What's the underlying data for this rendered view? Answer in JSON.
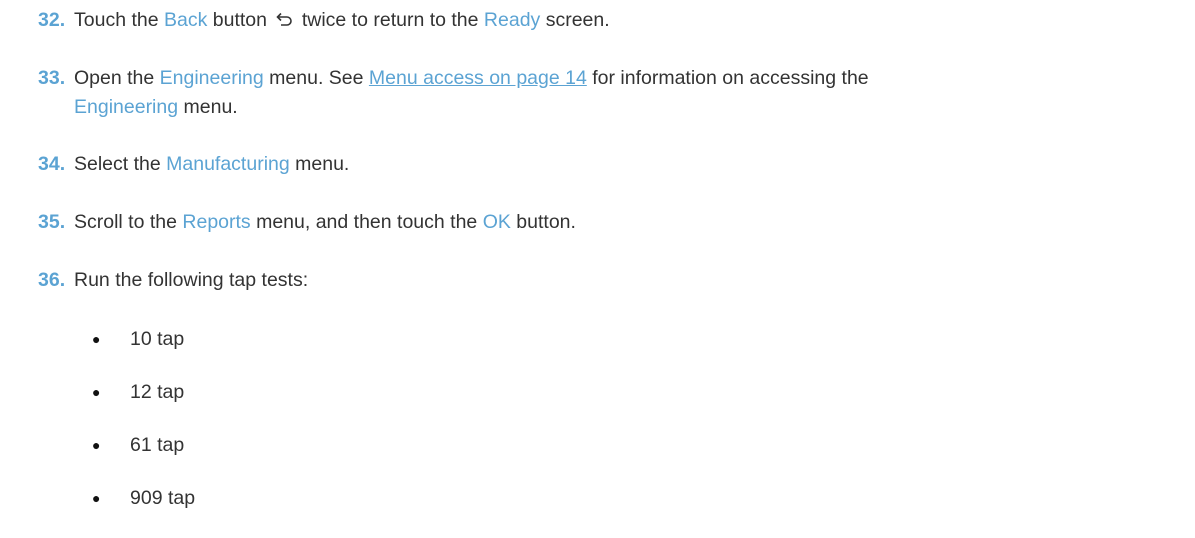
{
  "steps": [
    {
      "number": "32.",
      "parts": [
        {
          "t": "text",
          "v": "Touch the "
        },
        {
          "t": "ui",
          "v": "Back"
        },
        {
          "t": "text",
          "v": " button "
        },
        {
          "t": "icon",
          "v": "back-arrow"
        },
        {
          "t": "text",
          "v": " twice to return to the "
        },
        {
          "t": "ui",
          "v": "Ready"
        },
        {
          "t": "text",
          "v": " screen."
        }
      ]
    },
    {
      "number": "33.",
      "parts": [
        {
          "t": "text",
          "v": "Open the "
        },
        {
          "t": "ui",
          "v": "Engineering"
        },
        {
          "t": "text",
          "v": " menu. See "
        },
        {
          "t": "link",
          "v": "Menu access on page 14"
        },
        {
          "t": "text",
          "v": " for information on accessing the "
        },
        {
          "t": "ui",
          "v": "Engineering"
        },
        {
          "t": "text",
          "v": " menu."
        }
      ]
    },
    {
      "number": "34.",
      "parts": [
        {
          "t": "text",
          "v": "Select the "
        },
        {
          "t": "ui",
          "v": "Manufacturing"
        },
        {
          "t": "text",
          "v": " menu."
        }
      ]
    },
    {
      "number": "35.",
      "parts": [
        {
          "t": "text",
          "v": "Scroll to the "
        },
        {
          "t": "ui",
          "v": "Reports"
        },
        {
          "t": "text",
          "v": " menu, and then touch the "
        },
        {
          "t": "ui",
          "v": "OK"
        },
        {
          "t": "text",
          "v": " button."
        }
      ]
    },
    {
      "number": "36.",
      "parts": [
        {
          "t": "text",
          "v": "Run the following tap tests:"
        }
      ]
    }
  ],
  "bullets": {
    "marker": "●",
    "items": [
      "10 tap",
      "12 tap",
      "61 tap",
      "909 tap"
    ]
  },
  "colors": {
    "accent": "#5ba3d3",
    "text": "#333333"
  }
}
